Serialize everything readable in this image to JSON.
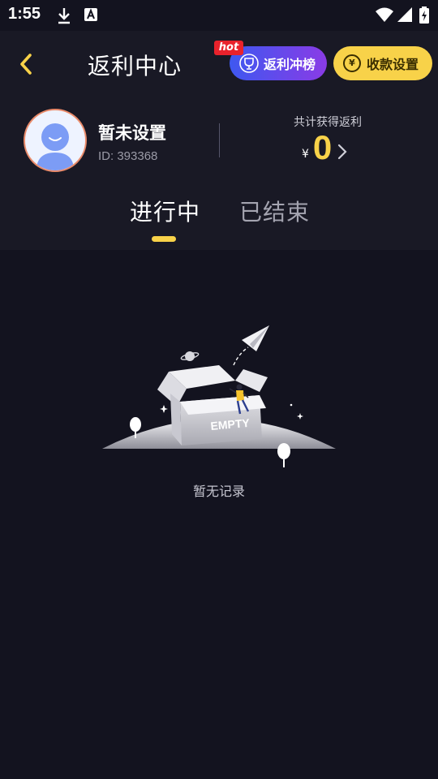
{
  "status_bar": {
    "time": "1:55",
    "icons": [
      "download-icon",
      "a-badge-icon",
      "wifi-icon",
      "signal-icon",
      "battery-charging-icon"
    ]
  },
  "header": {
    "title": "返利中心",
    "back_icon": "chevron-left-icon",
    "hot_badge": "hot",
    "rank_button": {
      "label": "返利冲榜",
      "icon": "trophy-icon"
    },
    "pay_button": {
      "label": "收款设置",
      "icon": "yen-coin-icon",
      "icon_glyph": "¥"
    }
  },
  "profile": {
    "username": "暂未设置",
    "user_id": "ID: 393368",
    "total_label": "共计获得返利",
    "currency": "¥",
    "total_value": "0"
  },
  "tabs": [
    {
      "label": "进行中",
      "active": true
    },
    {
      "label": "已结束",
      "active": false
    }
  ],
  "empty_state": {
    "box_label": "EMPTY",
    "message": "暂无记录"
  },
  "colors": {
    "background": "#13131f",
    "panel": "#191925",
    "accent_yellow": "#f8d249",
    "rank_gradient_start": "#3e58f0",
    "rank_gradient_end": "#8a3be6",
    "hot_red": "#e9222c"
  }
}
